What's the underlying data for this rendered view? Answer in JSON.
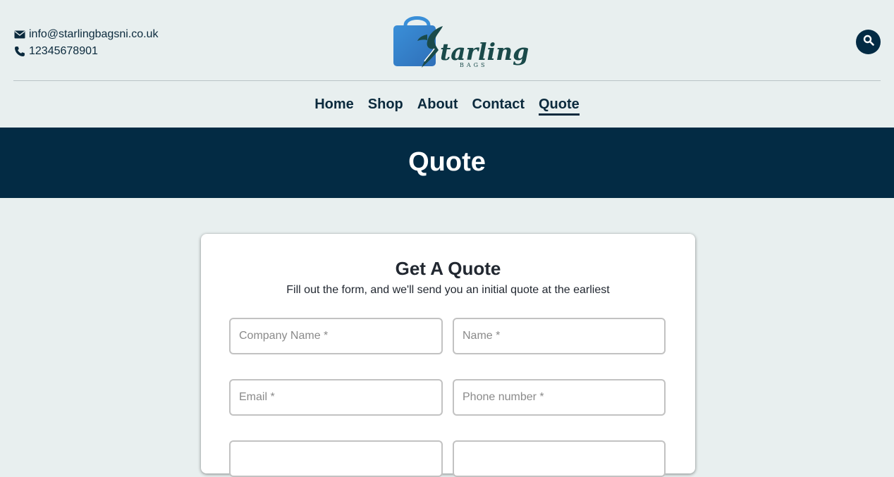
{
  "header": {
    "email": "info@starlingbagsni.co.uk",
    "phone": "12345678901",
    "logo": {
      "word": "Starling",
      "tagline": "BAGS",
      "icon": "shopping-bag-bird-logo"
    },
    "search_icon": "search-icon"
  },
  "nav": {
    "items": [
      {
        "label": "Home",
        "active": false
      },
      {
        "label": "Shop",
        "active": false
      },
      {
        "label": "About",
        "active": false
      },
      {
        "label": "Contact",
        "active": false
      },
      {
        "label": "Quote",
        "active": true
      }
    ]
  },
  "hero": {
    "title": "Quote"
  },
  "form": {
    "title": "Get A Quote",
    "subtitle": "Fill out the form, and we'll send you an initial quote at the earliest",
    "fields": [
      {
        "placeholder": "Company Name *",
        "value": ""
      },
      {
        "placeholder": "Name *",
        "value": ""
      },
      {
        "placeholder": "Email *",
        "value": ""
      },
      {
        "placeholder": "Phone number *",
        "value": ""
      },
      {
        "placeholder": "",
        "value": ""
      },
      {
        "placeholder": "",
        "value": ""
      }
    ]
  },
  "colors": {
    "page_bg": "#e8efef",
    "navy": "#032b44",
    "text": "#0b2a3d",
    "logo_blue": "#3a8fd8",
    "logo_teal": "#1a4a4a"
  }
}
